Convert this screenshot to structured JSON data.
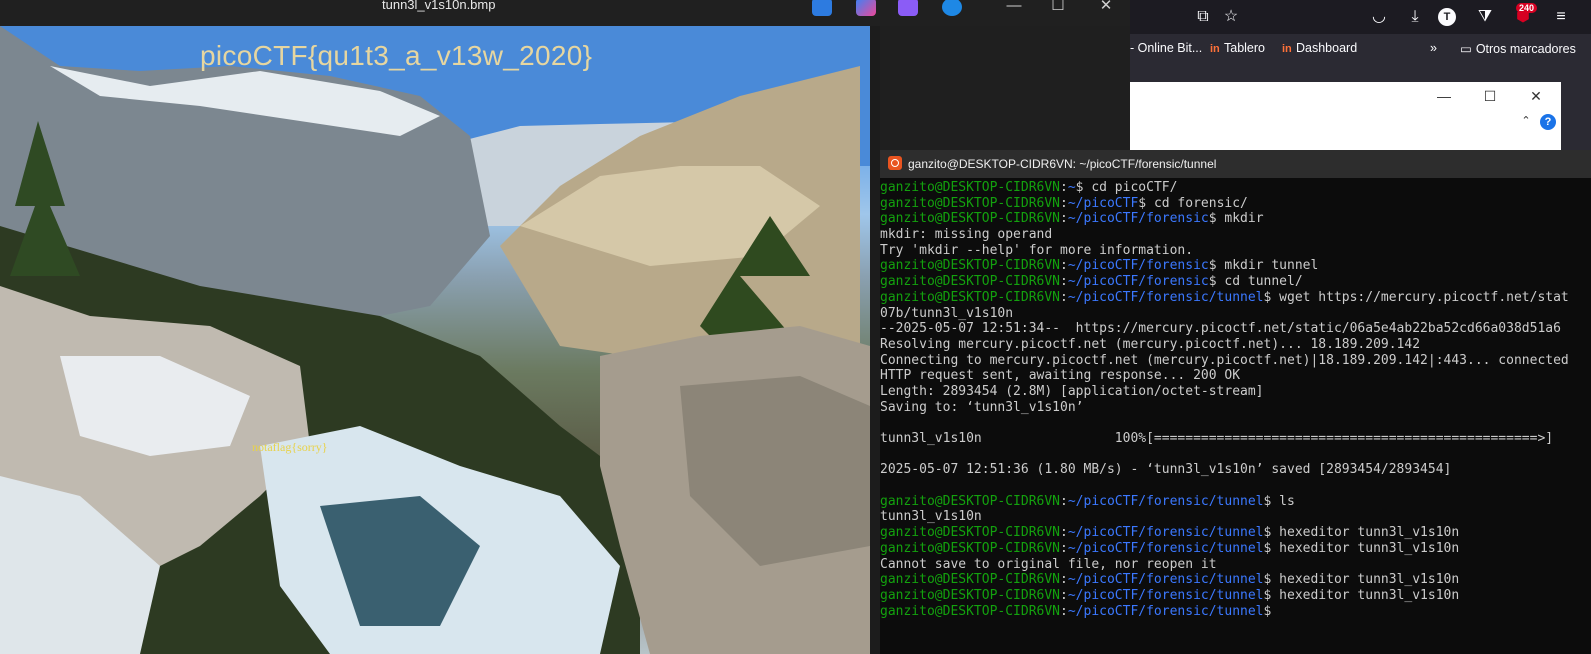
{
  "viewer": {
    "title": "tunn3l_v1s10n.bmp",
    "flag_text": "picoCTF{qu1t3_a_v13w_2020}",
    "fake_flag_text": "notaflag{sorry}"
  },
  "browser": {
    "bookmarks": [
      "- Online Bit...",
      "Tablero",
      "Dashboard",
      "Otros marcadores"
    ],
    "badge_count": "240",
    "account_initial": "T"
  },
  "terminal": {
    "title": "ganzito@DESKTOP-CIDR6VN: ~/picoCTF/forensic/tunnel",
    "lines": [
      {
        "user": "ganzito@DESKTOP-CIDR6VN",
        "path": "~",
        "cmd": "$ cd picoCTF/"
      },
      {
        "user": "ganzito@DESKTOP-CIDR6VN",
        "path": "~/picoCTF",
        "cmd": "$ cd forensic/"
      },
      {
        "user": "ganzito@DESKTOP-CIDR6VN",
        "path": "~/picoCTF/forensic",
        "cmd": "$ mkdir"
      },
      {
        "text": "mkdir: missing operand"
      },
      {
        "text": "Try 'mkdir --help' for more information."
      },
      {
        "user": "ganzito@DESKTOP-CIDR6VN",
        "path": "~/picoCTF/forensic",
        "cmd": "$ mkdir tunnel"
      },
      {
        "user": "ganzito@DESKTOP-CIDR6VN",
        "path": "~/picoCTF/forensic",
        "cmd": "$ cd tunnel/"
      },
      {
        "user": "ganzito@DESKTOP-CIDR6VN",
        "path": "~/picoCTF/forensic/tunnel",
        "cmd": "$ wget https://mercury.picoctf.net/stat"
      },
      {
        "text": "07b/tunn3l_v1s10n"
      },
      {
        "text": "--2025-05-07 12:51:34--  https://mercury.picoctf.net/static/06a5e4ab22ba52cd66a038d51a6"
      },
      {
        "text": "Resolving mercury.picoctf.net (mercury.picoctf.net)... 18.189.209.142"
      },
      {
        "text": "Connecting to mercury.picoctf.net (mercury.picoctf.net)|18.189.209.142|:443... connected"
      },
      {
        "text": "HTTP request sent, awaiting response... 200 OK"
      },
      {
        "text": "Length: 2893454 (2.8M) [application/octet-stream]"
      },
      {
        "text": "Saving to: ‘tunn3l_v1s10n’"
      },
      {
        "text": ""
      },
      {
        "text": "tunn3l_v1s10n                 100%[=================================================>]"
      },
      {
        "text": ""
      },
      {
        "text": "2025-05-07 12:51:36 (1.80 MB/s) - ‘tunn3l_v1s10n’ saved [2893454/2893454]"
      },
      {
        "text": ""
      },
      {
        "user": "ganzito@DESKTOP-CIDR6VN",
        "path": "~/picoCTF/forensic/tunnel",
        "cmd": "$ ls"
      },
      {
        "text": "tunn3l_v1s10n"
      },
      {
        "user": "ganzito@DESKTOP-CIDR6VN",
        "path": "~/picoCTF/forensic/tunnel",
        "cmd": "$ hexeditor tunn3l_v1s10n"
      },
      {
        "user": "ganzito@DESKTOP-CIDR6VN",
        "path": "~/picoCTF/forensic/tunnel",
        "cmd": "$ hexeditor tunn3l_v1s10n"
      },
      {
        "text": "Cannot save to original file, nor reopen it"
      },
      {
        "user": "ganzito@DESKTOP-CIDR6VN",
        "path": "~/picoCTF/forensic/tunnel",
        "cmd": "$ hexeditor tunn3l_v1s10n"
      },
      {
        "user": "ganzito@DESKTOP-CIDR6VN",
        "path": "~/picoCTF/forensic/tunnel",
        "cmd": "$ hexeditor tunn3l_v1s10n"
      },
      {
        "user": "ganzito@DESKTOP-CIDR6VN",
        "path": "~/picoCTF/forensic/tunnel",
        "cmd": "$"
      }
    ]
  }
}
